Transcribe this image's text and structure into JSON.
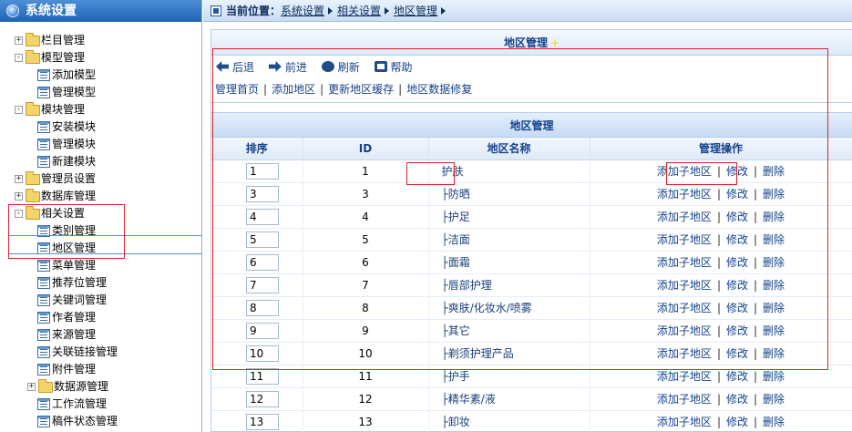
{
  "sidebar": {
    "title": "系统设置",
    "items": [
      {
        "label": "栏目管理",
        "type": "folder",
        "expand": "+",
        "level": 0
      },
      {
        "label": "模型管理",
        "type": "folder",
        "expand": "-",
        "level": 0
      },
      {
        "label": "添加模型",
        "type": "page",
        "level": 1
      },
      {
        "label": "管理模型",
        "type": "page",
        "level": 1
      },
      {
        "label": "模块管理",
        "type": "folder",
        "expand": "-",
        "level": 0
      },
      {
        "label": "安装模块",
        "type": "page",
        "level": 1
      },
      {
        "label": "管理模块",
        "type": "page",
        "level": 1
      },
      {
        "label": "新建模块",
        "type": "page",
        "level": 1
      },
      {
        "label": "管理员设置",
        "type": "folder",
        "expand": "+",
        "level": 0
      },
      {
        "label": "数据库管理",
        "type": "folder",
        "expand": "+",
        "level": 0
      },
      {
        "label": "相关设置",
        "type": "folder",
        "expand": "-",
        "level": 0
      },
      {
        "label": "类别管理",
        "type": "page",
        "level": 1
      },
      {
        "label": "地区管理",
        "type": "page",
        "level": 1
      },
      {
        "label": "菜单管理",
        "type": "page",
        "level": 1
      },
      {
        "label": "推荐位管理",
        "type": "page",
        "level": 1
      },
      {
        "label": "关键词管理",
        "type": "page",
        "level": 1
      },
      {
        "label": "作者管理",
        "type": "page",
        "level": 1
      },
      {
        "label": "来源管理",
        "type": "page",
        "level": 1
      },
      {
        "label": "关联链接管理",
        "type": "page",
        "level": 1
      },
      {
        "label": "附件管理",
        "type": "page",
        "level": 1
      },
      {
        "label": "数据源管理",
        "type": "folder",
        "expand": "+",
        "level": 1
      },
      {
        "label": "工作流管理",
        "type": "page",
        "level": 1
      },
      {
        "label": "稿件状态管理",
        "type": "page",
        "level": 1
      }
    ]
  },
  "breadcrumb": {
    "prefix": "当前位置：",
    "items": [
      "系统设置",
      "相关设置",
      "地区管理"
    ]
  },
  "panel": {
    "title": "地区管理",
    "star": "+"
  },
  "toolbar": {
    "back": "后退",
    "forward": "前进",
    "refresh": "刷新",
    "help": "帮助"
  },
  "links": [
    "管理首页",
    "添加地区",
    "更新地区缓存",
    "地区数据修复"
  ],
  "grid": {
    "title": "地区管理",
    "columns": [
      "排序",
      "ID",
      "地区名称",
      "管理操作"
    ],
    "ops": {
      "add_child": "添加子地区",
      "edit": "修改",
      "delete": "删除"
    },
    "rows": [
      {
        "order": "1",
        "id": "1",
        "name": "护肤"
      },
      {
        "order": "3",
        "id": "3",
        "name": "├防晒"
      },
      {
        "order": "4",
        "id": "4",
        "name": "├护足"
      },
      {
        "order": "5",
        "id": "5",
        "name": "├洁面"
      },
      {
        "order": "6",
        "id": "6",
        "name": "├面霜"
      },
      {
        "order": "7",
        "id": "7",
        "name": "├唇部护理"
      },
      {
        "order": "8",
        "id": "8",
        "name": "├爽肤/化妆水/喷雾"
      },
      {
        "order": "9",
        "id": "9",
        "name": "├其它"
      },
      {
        "order": "10",
        "id": "10",
        "name": "├剃须护理产品"
      },
      {
        "order": "11",
        "id": "11",
        "name": "├护手"
      },
      {
        "order": "12",
        "id": "12",
        "name": "├精华素/液"
      },
      {
        "order": "13",
        "id": "13",
        "name": "├卸妆"
      }
    ]
  },
  "colors": {
    "accent": "#15428b",
    "header_blue": "#1f63b4",
    "annotation_red": "#e0202a"
  }
}
